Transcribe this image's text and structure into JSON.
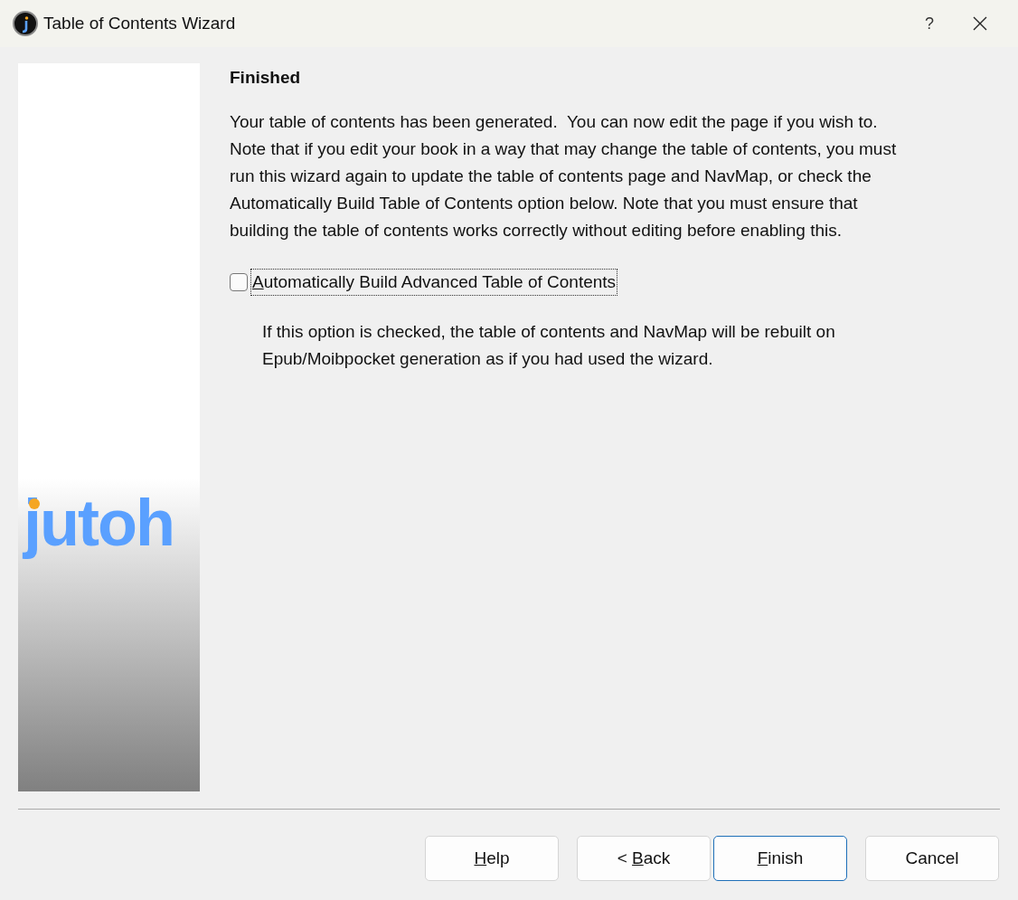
{
  "window": {
    "title": "Table of Contents Wizard",
    "help": "?"
  },
  "sidebar": {
    "logo": "jutoh"
  },
  "page": {
    "heading": "Finished",
    "description": "Your table of contents has been generated.  You can now edit the page if you wish to. Note that if you edit your book in a way that may change the table of contents, you must run this wizard again to update the table of contents page and NavMap, or check the Automatically Build Table of Contents option below. Note that you must ensure that building the table of contents works correctly without editing before enabling this.",
    "option": {
      "label": {
        "access_key": "A",
        "rest": "utomatically Build Advanced Table of Contents"
      },
      "checked": false,
      "focused": true
    },
    "option_help": "If this option is checked, the table of contents and NavMap will be rebuilt on Epub/Moibpocket generation as if you had used the wizard."
  },
  "buttons": [
    {
      "label": {
        "access_key": "H",
        "rest": "elp"
      },
      "default": false
    },
    {
      "label": {
        "prefix": "< ",
        "access_key": "B",
        "rest": "ack"
      },
      "default": false
    },
    {
      "label": {
        "access_key": "F",
        "rest": "inish"
      },
      "default": true
    },
    {
      "label": {
        "rest": "Cancel"
      },
      "default": false
    }
  ]
}
